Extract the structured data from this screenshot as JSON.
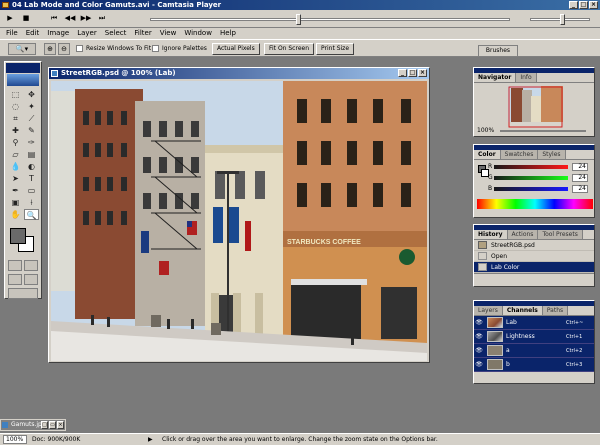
{
  "player": {
    "title": "04 Lab Mode and Color Gamuts.avi - Camtasia Player",
    "controls": [
      "▶",
      "■",
      "⏮",
      "◀◀",
      "▶▶",
      "⏭"
    ]
  },
  "menu": [
    "File",
    "Edit",
    "Image",
    "Layer",
    "Select",
    "Filter",
    "View",
    "Window",
    "Help"
  ],
  "options": {
    "resize_label": "Resize Windows To Fit",
    "ignore_label": "Ignore Palettes",
    "actual_pixels": "Actual Pixels",
    "fit_on_screen": "Fit On Screen",
    "print_size": "Print Size",
    "brushes_tab": "Brushes"
  },
  "document": {
    "title": "StreetRGB.psd @ 100% (Lab)"
  },
  "navigator": {
    "tabs": [
      "Navigator",
      "Info"
    ],
    "zoom": "100%"
  },
  "color": {
    "tabs": [
      "Color",
      "Swatches",
      "Styles"
    ],
    "rows": [
      {
        "label": "R",
        "value": "24"
      },
      {
        "label": "G",
        "value": "24"
      },
      {
        "label": "B",
        "value": "24"
      }
    ]
  },
  "history": {
    "tabs": [
      "History",
      "Actions",
      "Tool Presets"
    ],
    "items": [
      "StreetRGB.psd",
      "Open",
      "Lab Color"
    ]
  },
  "channels": {
    "tabs": [
      "Layers",
      "Channels",
      "Paths"
    ],
    "items": [
      {
        "name": "Lab",
        "key": "Ctrl+~"
      },
      {
        "name": "Lightness",
        "key": "Ctrl+1"
      },
      {
        "name": "a",
        "key": "Ctrl+2"
      },
      {
        "name": "b",
        "key": "Ctrl+3"
      }
    ]
  },
  "minimized": {
    "title": "Gamuts.jpg"
  },
  "status": {
    "zoom": "100%",
    "doc": "Doc: 900K/900K",
    "message": "Click or drag over the area you want to enlarge. Change the zoom state on the Options bar."
  },
  "sign_text": "STARBUCKS COFFEE"
}
